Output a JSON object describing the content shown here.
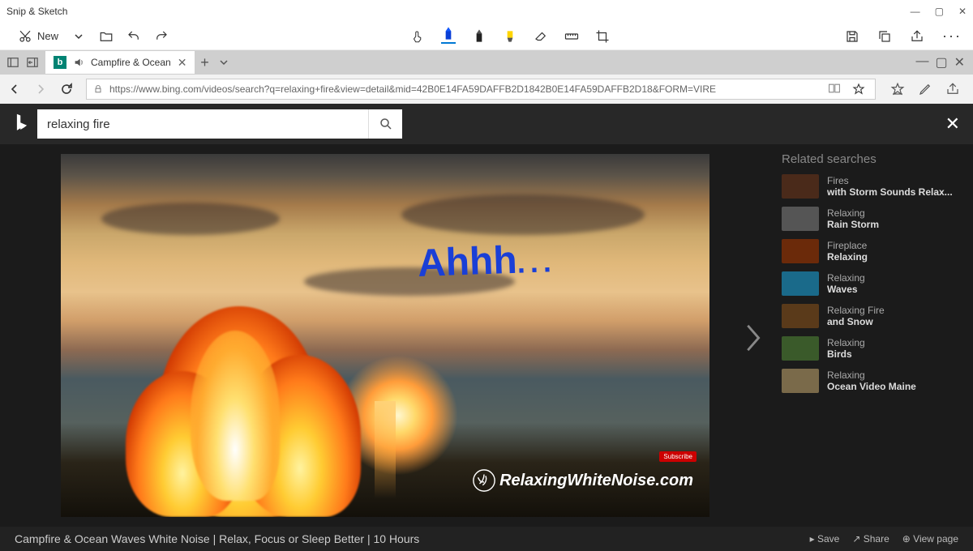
{
  "app": {
    "title": "Snip & Sketch"
  },
  "window_buttons": {
    "min": "—",
    "max": "▢",
    "close": "✕"
  },
  "snip_toolbar": {
    "new_label": "New",
    "icons": {
      "new": "new-snip-icon",
      "new_dropdown": "chevron-down-icon",
      "open": "folder-open-icon",
      "undo": "undo-icon",
      "redo": "redo-icon",
      "touch": "touch-writing-icon",
      "pen_blue": "pen-icon",
      "pen_black": "pencil-icon",
      "highlighter": "highlighter-icon",
      "eraser": "eraser-icon",
      "ruler": "ruler-icon",
      "crop": "crop-icon",
      "save": "save-icon",
      "copy": "copy-icon",
      "share": "share-icon",
      "more": "more-icon"
    }
  },
  "browser": {
    "tab_title": "Campfire & Ocean",
    "url": "https://www.bing.com/videos/search?q=relaxing+fire&view=detail&mid=42B0E14FA59DAFFB2D1842B0E14FA59DAFFB2D18&FORM=VIRE",
    "nav": {
      "back": "←",
      "forward": "→",
      "refresh": "↻"
    }
  },
  "bing": {
    "query": "relaxing fire",
    "annotation": "Ahhh",
    "annotation_dots": "...",
    "watermark": "RelaxingWhiteNoise.com",
    "subscribe": "Subscribe",
    "related_title": "Related searches",
    "related": [
      {
        "l1": "Fires",
        "l2": "with Storm Sounds Relax..."
      },
      {
        "l1": "Relaxing",
        "l2": "Rain Storm"
      },
      {
        "l1": "Fireplace",
        "l2": "Relaxing"
      },
      {
        "l1": "Relaxing",
        "l2": "Waves"
      },
      {
        "l1": "Relaxing Fire",
        "l2": "and Snow"
      },
      {
        "l1": "Relaxing",
        "l2": "Birds"
      },
      {
        "l1": "Relaxing",
        "l2": "Ocean Video Maine"
      }
    ],
    "video_title": "Campfire & Ocean Waves White Noise | Relax, Focus or Sleep Better | 10 Hours",
    "footer_actions": {
      "save": "Save",
      "share": "Share",
      "view": "View page"
    }
  }
}
